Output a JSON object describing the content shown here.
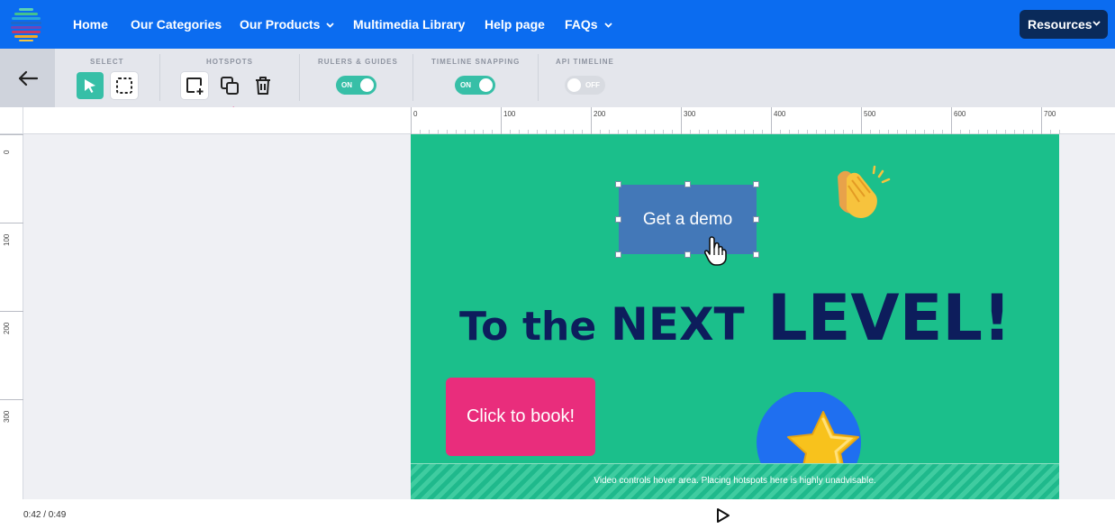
{
  "nav": {
    "items": [
      {
        "label": "Home",
        "dropdown": false
      },
      {
        "label": "Our Categories",
        "dropdown": false
      },
      {
        "label": "Our Products",
        "dropdown": true
      },
      {
        "label": "Multimedia Library",
        "dropdown": false
      },
      {
        "label": "Help page",
        "dropdown": false
      },
      {
        "label": "FAQs",
        "dropdown": true
      }
    ],
    "resources_label": "Resources",
    "colors": {
      "bar": "#0b6cf0",
      "resources_bg": "#0a2a5a"
    }
  },
  "toolbar": {
    "select": {
      "label": "SELECT",
      "tools": [
        "pointer-icon",
        "marquee-select-icon"
      ],
      "active": "pointer-icon"
    },
    "hotspots": {
      "label": "HOTSPOTS",
      "tools": [
        "add-hotspot-icon",
        "duplicate-icon",
        "trash-icon"
      ]
    },
    "rulers": {
      "label": "RULERS & GUIDES",
      "toggle": "ON",
      "on": true
    },
    "snapping": {
      "label": "TIMELINE SNAPPING",
      "toggle": "ON",
      "on": true
    },
    "api": {
      "label": "API TIMELINE",
      "toggle": "OFF",
      "on": false
    },
    "accent": "#37bfa7"
  },
  "rulers": {
    "top_ticks": [
      "0",
      "100",
      "200",
      "300",
      "400",
      "500",
      "600",
      "700"
    ],
    "left_ticks": [
      "0",
      "100",
      "200",
      "300"
    ]
  },
  "stage": {
    "background": "#1bbf8b",
    "demo_button": "Get a demo",
    "headline": {
      "part1": "To",
      "part2": "the",
      "part3": "NEXT",
      "part4": "LEVEL!"
    },
    "book_button": "Click to book!",
    "video_zone_text": "Video controls hover area. Placing hotspots here is highly unadvisable.",
    "emoji": [
      "clapping-hands",
      "star"
    ]
  },
  "player": {
    "time": "0:42 / 0:49"
  }
}
